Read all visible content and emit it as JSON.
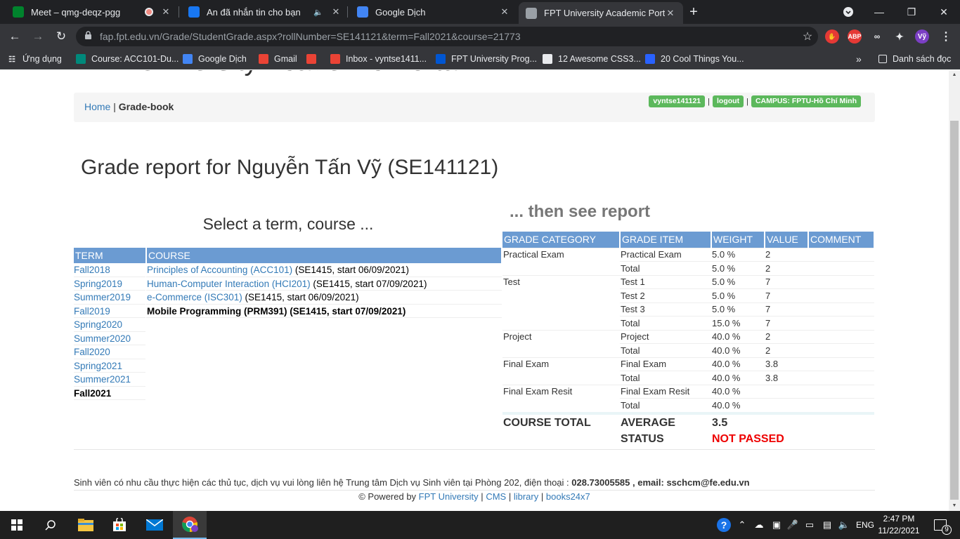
{
  "browser": {
    "tabs": [
      {
        "title": "Meet – qmg-deqz-pgg",
        "favicon": "meet-icon",
        "color": "#00832d"
      },
      {
        "title": "An đã nhắn tin cho bạn",
        "favicon": "facebook-icon",
        "color": "#1877f2"
      },
      {
        "title": "Google Dịch",
        "favicon": "google-translate-icon",
        "color": "#4285f4"
      },
      {
        "title": "FPT University Academic Portal",
        "favicon": "globe-icon",
        "color": "#9aa0a6"
      }
    ],
    "url": "fap.fpt.edu.vn/Grade/StudentGrade.aspx?rollNumber=SE141121&term=Fall2021&course=21773",
    "profile_initials": "Vỹ",
    "bookmarks": [
      {
        "label": "Ứng dụng",
        "icon": "apps-grid-icon"
      },
      {
        "label": "Course: ACC101-Du...",
        "icon": "course-icon"
      },
      {
        "label": "Google Dịch",
        "icon": "google-translate-icon"
      },
      {
        "label": "Gmail",
        "icon": "gmail-icon"
      },
      {
        "label": "",
        "icon": "gmail-icon"
      },
      {
        "label": "Inbox - vyntse1411...",
        "icon": "gmail-icon"
      },
      {
        "label": "FPT University Prog...",
        "icon": "coursera-icon"
      },
      {
        "label": "12 Awesome CSS3...",
        "icon": "code-icon"
      },
      {
        "label": "20 Cool Things You...",
        "icon": "hashnode-icon"
      }
    ],
    "reading_list": "Danh sách đọc"
  },
  "page": {
    "site_title": "FPT University Academic Portal",
    "breadcrumb": {
      "home": "Home",
      "separator": "|",
      "current": "Grade-book"
    },
    "user_labels": [
      "vyntse141121",
      "logout",
      "CAMPUS: FPTU-Hồ Chí Minh"
    ],
    "heading": "Grade report for Nguyễn Tấn Vỹ (SE141121)",
    "select_heading": "Select a term, course ...",
    "then_heading": "... then see report",
    "term_table": {
      "headers": [
        "TERM",
        "COURSE"
      ],
      "terms": [
        "Fall2018",
        "Spring2019",
        "Summer2019",
        "Fall2019",
        "Spring2020",
        "Summer2020",
        "Fall2020",
        "Spring2021",
        "Summer2021",
        "Fall2021"
      ],
      "courses": [
        {
          "link": "Principles of Accounting (ACC101)",
          "info": " (SE1415, start 06/09/2021)"
        },
        {
          "link": "Human-Computer Interaction (HCI201)",
          "info": " (SE1415, start 07/09/2021)"
        },
        {
          "link": "e-Commerce (ISC301)",
          "info": " (SE1415, start 06/09/2021)"
        },
        {
          "selected": "Mobile Programming (PRM391) (SE1415, start 07/09/2021)"
        }
      ]
    },
    "grade_table": {
      "headers": [
        "GRADE CATEGORY",
        "GRADE ITEM",
        "WEIGHT",
        "VALUE",
        "COMMENT"
      ],
      "groups": [
        {
          "category": "Practical Exam",
          "rows": [
            {
              "item": "Practical Exam",
              "weight": "5.0 %",
              "value": "2",
              "comment": ""
            },
            {
              "item": "Total",
              "weight": "5.0 %",
              "value": "2",
              "comment": ""
            }
          ]
        },
        {
          "category": "Test",
          "rows": [
            {
              "item": "Test 1",
              "weight": "5.0 %",
              "value": "7",
              "comment": ""
            },
            {
              "item": "Test 2",
              "weight": "5.0 %",
              "value": "7",
              "comment": ""
            },
            {
              "item": "Test 3",
              "weight": "5.0 %",
              "value": "7",
              "comment": ""
            },
            {
              "item": "Total",
              "weight": "15.0 %",
              "value": "7",
              "comment": ""
            }
          ]
        },
        {
          "category": "Project",
          "rows": [
            {
              "item": "Project",
              "weight": "40.0 %",
              "value": "2",
              "comment": ""
            },
            {
              "item": "Total",
              "weight": "40.0 %",
              "value": "2",
              "comment": ""
            }
          ]
        },
        {
          "category": "Final Exam",
          "rows": [
            {
              "item": "Final Exam",
              "weight": "40.0 %",
              "value": "3.8",
              "comment": ""
            },
            {
              "item": "Total",
              "weight": "40.0 %",
              "value": "3.8",
              "comment": ""
            }
          ]
        },
        {
          "category": "Final Exam Resit",
          "rows": [
            {
              "item": "Final Exam Resit",
              "weight": "40.0 %",
              "value": "",
              "comment": ""
            },
            {
              "item": "Total",
              "weight": "40.0 %",
              "value": "",
              "comment": ""
            }
          ]
        }
      ],
      "course_total_label": "COURSE TOTAL",
      "average_label": "AVERAGE",
      "average_value": "3.5",
      "status_label": "STATUS",
      "status_value": "NOT PASSED"
    },
    "footer": {
      "contact_text": "Sinh viên có nhu cầu thực hiện các thủ tục, dịch vụ vui lòng liên hệ Trung tâm Dịch vụ Sinh viên tại Phòng 202, điện thoại : ",
      "phone": "028.73005585",
      "email_label": " , email: ",
      "email": "sschcm@fe.edu.vn",
      "powered_by": "© Powered by ",
      "links": [
        "FPT University",
        "CMS",
        "library",
        "books24x7"
      ],
      "separator": "|"
    }
  },
  "taskbar": {
    "language": "ENG",
    "time": "2:47 PM",
    "date": "11/22/2021",
    "notification_count": "9"
  }
}
